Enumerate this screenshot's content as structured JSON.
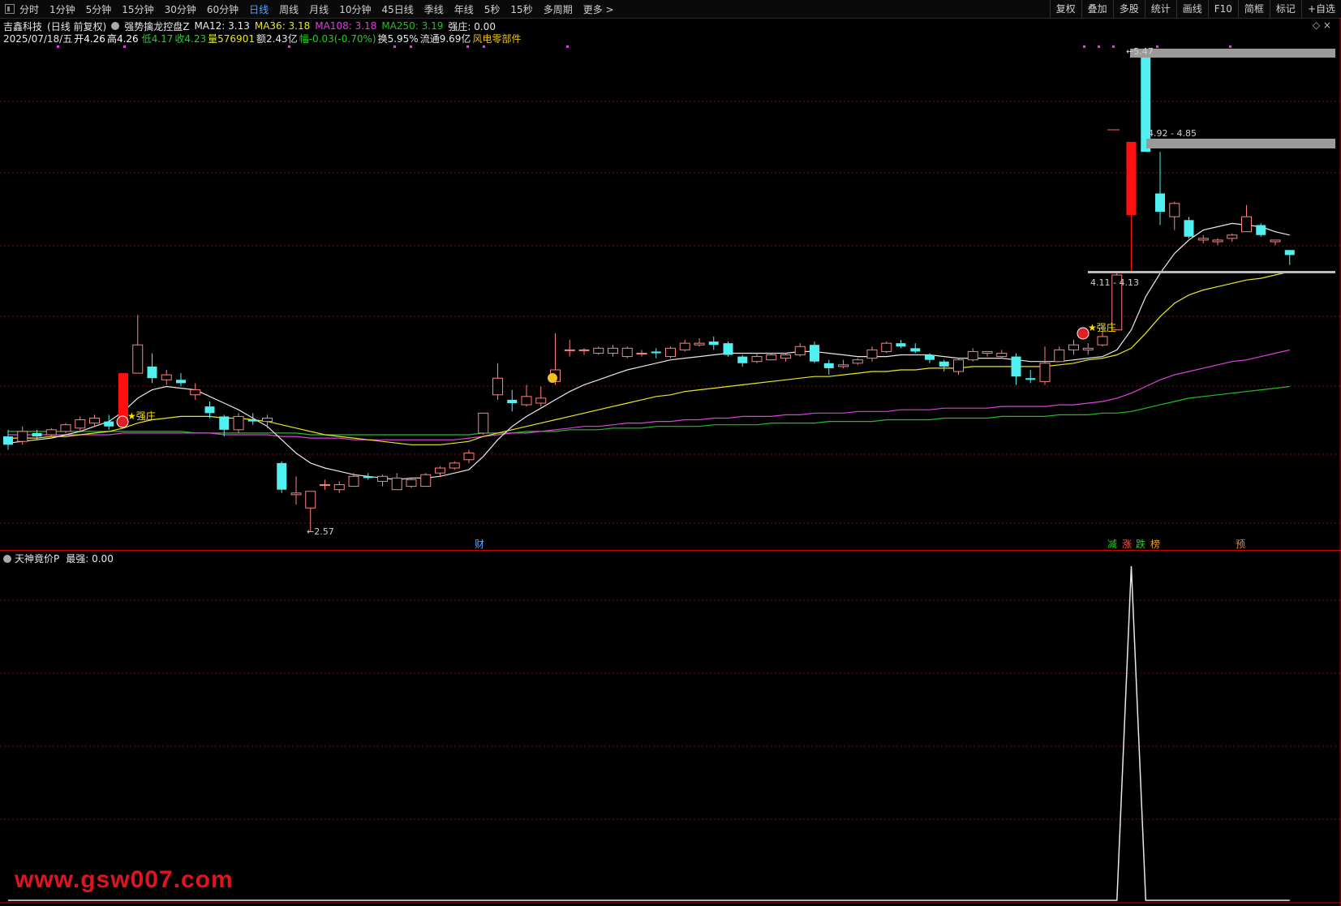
{
  "toolbar": {
    "periods": [
      "分时",
      "1分钟",
      "5分钟",
      "15分钟",
      "30分钟",
      "60分钟",
      "日线",
      "周线",
      "月线",
      "10分钟",
      "45日线",
      "季线",
      "年线",
      "5秒",
      "15秒",
      "多周期",
      "更多 >"
    ],
    "active_period": "日线",
    "right_tools": [
      "复权",
      "叠加",
      "多股",
      "统计",
      "画线",
      "F10",
      "简框",
      "标记",
      "+自选"
    ]
  },
  "header": {
    "stock_name": "吉鑫科技",
    "mode": "(日线 前复权)",
    "formula_name": "强势擒龙控盘Z",
    "ma12": "MA12: 3.13",
    "ma36": "MA36: 3.18",
    "ma108": "MA108: 3.18",
    "ma250": "MA250: 3.19",
    "strength": "强庄: 0.00",
    "settings_icon": "◇ ×"
  },
  "quote": {
    "date": "2025/07/18/五",
    "open": "开4.26",
    "high": "高4.26",
    "low": "低4.17",
    "close": "收4.23",
    "volume": "量576901",
    "amount": "额2.43亿",
    "change": "幅-0.03(-0.70%)",
    "turnover": "换5.95%",
    "float_cap": "流通9.69亿",
    "sector": "风电零部件"
  },
  "colors": {
    "up": "#ff8080",
    "up_strong": "#ff1010",
    "down": "#50f0f0",
    "ma12": "#e8e8e8",
    "ma36": "#e8e820",
    "ma108": "#e040e0",
    "ma250": "#20c020",
    "grid": "#7a1010",
    "accent_active": "#4fa8ff"
  },
  "chart_annotations": {
    "low_label": "←2.57",
    "high_label": "←5.47",
    "zone_upper": "4.92 - 4.85",
    "zone_lower": "4.11 - 4.13",
    "signal_label_1": "★强庄",
    "signal_label_2": "★强庄",
    "finance_mark": "财",
    "markers": [
      "减",
      "涨",
      "跌",
      "榜",
      "预"
    ]
  },
  "indicator": {
    "name": "天神竟价P",
    "value": "最强: 0.00"
  },
  "watermark": "www.gsw007.com",
  "chart_data": {
    "type": "candlestick",
    "price_range": [
      2.57,
      5.47
    ],
    "candles": [
      [
        3.14,
        3.09,
        3.18,
        3.06
      ],
      [
        3.11,
        3.17,
        3.2,
        3.09
      ],
      [
        3.16,
        3.14,
        3.18,
        3.12
      ],
      [
        3.15,
        3.18,
        3.19,
        3.14
      ],
      [
        3.17,
        3.21,
        3.22,
        3.16
      ],
      [
        3.19,
        3.24,
        3.26,
        3.17
      ],
      [
        3.22,
        3.25,
        3.27,
        3.2
      ],
      [
        3.23,
        3.2,
        3.27,
        3.18
      ],
      [
        3.21,
        3.52,
        3.52,
        3.2
      ],
      [
        3.52,
        3.69,
        3.87,
        3.52
      ],
      [
        3.56,
        3.49,
        3.64,
        3.46
      ],
      [
        3.48,
        3.51,
        3.54,
        3.45
      ],
      [
        3.48,
        3.46,
        3.52,
        3.44
      ],
      [
        3.39,
        3.42,
        3.46,
        3.36
      ],
      [
        3.32,
        3.28,
        3.35,
        3.25
      ],
      [
        3.26,
        3.18,
        3.27,
        3.14
      ],
      [
        3.18,
        3.26,
        3.28,
        3.16
      ],
      [
        3.24,
        3.23,
        3.28,
        3.21
      ],
      [
        3.23,
        3.25,
        3.27,
        3.19
      ],
      [
        2.98,
        2.82,
        2.99,
        2.8
      ],
      [
        2.79,
        2.8,
        2.9,
        2.73
      ],
      [
        2.71,
        2.81,
        2.81,
        2.57
      ],
      [
        2.85,
        2.85,
        2.88,
        2.82
      ],
      [
        2.82,
        2.85,
        2.87,
        2.8
      ],
      [
        2.84,
        2.9,
        2.92,
        2.84
      ],
      [
        2.9,
        2.89,
        2.92,
        2.88
      ],
      [
        2.87,
        2.9,
        2.91,
        2.84
      ],
      [
        2.82,
        2.89,
        2.92,
        2.82
      ],
      [
        2.84,
        2.88,
        2.89,
        2.83
      ],
      [
        2.84,
        2.91,
        2.92,
        2.84
      ],
      [
        2.92,
        2.95,
        2.96,
        2.9
      ],
      [
        2.95,
        2.98,
        2.99,
        2.94
      ],
      [
        3.0,
        3.04,
        3.06,
        2.98
      ],
      [
        3.16,
        3.28,
        3.28,
        3.15
      ],
      [
        3.39,
        3.49,
        3.58,
        3.36
      ],
      [
        3.36,
        3.34,
        3.42,
        3.29
      ],
      [
        3.33,
        3.38,
        3.45,
        3.32
      ],
      [
        3.34,
        3.37,
        3.44,
        3.32
      ],
      [
        3.47,
        3.54,
        3.76,
        3.45
      ],
      [
        3.66,
        3.66,
        3.72,
        3.62
      ],
      [
        3.66,
        3.66,
        3.67,
        3.63
      ],
      [
        3.64,
        3.67,
        3.68,
        3.63
      ],
      [
        3.64,
        3.67,
        3.69,
        3.62
      ],
      [
        3.62,
        3.67,
        3.68,
        3.61
      ],
      [
        3.64,
        3.64,
        3.66,
        3.62
      ],
      [
        3.65,
        3.64,
        3.67,
        3.61
      ],
      [
        3.62,
        3.67,
        3.68,
        3.61
      ],
      [
        3.66,
        3.7,
        3.72,
        3.65
      ],
      [
        3.69,
        3.7,
        3.73,
        3.68
      ],
      [
        3.71,
        3.69,
        3.74,
        3.66
      ],
      [
        3.7,
        3.63,
        3.71,
        3.62
      ],
      [
        3.62,
        3.58,
        3.63,
        3.56
      ],
      [
        3.59,
        3.62,
        3.64,
        3.58
      ],
      [
        3.6,
        3.63,
        3.64,
        3.6
      ],
      [
        3.61,
        3.63,
        3.64,
        3.59
      ],
      [
        3.63,
        3.68,
        3.7,
        3.62
      ],
      [
        3.69,
        3.59,
        3.71,
        3.58
      ],
      [
        3.58,
        3.55,
        3.6,
        3.51
      ],
      [
        3.56,
        3.57,
        3.6,
        3.55
      ],
      [
        3.58,
        3.6,
        3.61,
        3.57
      ],
      [
        3.61,
        3.66,
        3.68,
        3.59
      ],
      [
        3.65,
        3.7,
        3.71,
        3.64
      ],
      [
        3.7,
        3.68,
        3.72,
        3.67
      ],
      [
        3.67,
        3.65,
        3.7,
        3.64
      ],
      [
        3.63,
        3.6,
        3.64,
        3.58
      ],
      [
        3.59,
        3.56,
        3.6,
        3.53
      ],
      [
        3.53,
        3.6,
        3.61,
        3.51
      ],
      [
        3.6,
        3.65,
        3.67,
        3.59
      ],
      [
        3.64,
        3.65,
        3.65,
        3.62
      ],
      [
        3.62,
        3.64,
        3.66,
        3.61
      ],
      [
        3.62,
        3.5,
        3.64,
        3.45
      ],
      [
        3.49,
        3.48,
        3.54,
        3.46
      ],
      [
        3.47,
        3.58,
        3.68,
        3.45
      ],
      [
        3.59,
        3.66,
        3.68,
        3.59
      ],
      [
        3.66,
        3.69,
        3.72,
        3.63
      ],
      [
        3.66,
        3.67,
        3.7,
        3.63
      ],
      [
        3.69,
        3.74,
        3.77,
        3.68
      ],
      [
        3.78,
        4.11,
        4.12,
        3.78
      ],
      [
        4.47,
        4.91,
        4.91,
        4.13
      ],
      [
        5.47,
        4.85,
        5.47,
        4.85
      ],
      [
        4.6,
        4.49,
        4.85,
        4.41
      ],
      [
        4.46,
        4.54,
        4.55,
        4.38
      ],
      [
        4.44,
        4.34,
        4.46,
        4.33
      ],
      [
        4.32,
        4.33,
        4.35,
        4.3
      ],
      [
        4.31,
        4.32,
        4.33,
        4.29
      ],
      [
        4.33,
        4.35,
        4.36,
        4.31
      ],
      [
        4.37,
        4.46,
        4.53,
        4.37
      ],
      [
        4.41,
        4.35,
        4.42,
        4.34
      ],
      [
        4.31,
        4.32,
        4.32,
        4.29
      ],
      [
        4.26,
        4.23,
        4.26,
        4.17
      ]
    ],
    "ma12": [
      3.1,
      3.11,
      3.12,
      3.13,
      3.15,
      3.17,
      3.2,
      3.23,
      3.29,
      3.37,
      3.42,
      3.44,
      3.43,
      3.42,
      3.38,
      3.34,
      3.3,
      3.25,
      3.2,
      3.12,
      3.04,
      2.98,
      2.95,
      2.93,
      2.91,
      2.9,
      2.89,
      2.88,
      2.89,
      2.89,
      2.9,
      2.92,
      2.94,
      3.02,
      3.12,
      3.2,
      3.26,
      3.31,
      3.36,
      3.41,
      3.45,
      3.48,
      3.51,
      3.54,
      3.56,
      3.58,
      3.6,
      3.61,
      3.62,
      3.63,
      3.64,
      3.64,
      3.64,
      3.64,
      3.64,
      3.65,
      3.65,
      3.64,
      3.63,
      3.62,
      3.62,
      3.62,
      3.63,
      3.63,
      3.63,
      3.62,
      3.61,
      3.61,
      3.61,
      3.61,
      3.6,
      3.59,
      3.59,
      3.59,
      3.6,
      3.61,
      3.62,
      3.66,
      3.78,
      3.98,
      4.12,
      4.24,
      4.32,
      4.38,
      4.4,
      4.42,
      4.41,
      4.4,
      4.37,
      4.35
    ],
    "ma36": [
      3.13,
      3.13,
      3.13,
      3.14,
      3.14,
      3.15,
      3.16,
      3.17,
      3.19,
      3.22,
      3.24,
      3.25,
      3.26,
      3.26,
      3.26,
      3.25,
      3.25,
      3.24,
      3.23,
      3.21,
      3.19,
      3.17,
      3.15,
      3.14,
      3.13,
      3.12,
      3.11,
      3.1,
      3.09,
      3.09,
      3.09,
      3.1,
      3.11,
      3.14,
      3.16,
      3.18,
      3.2,
      3.22,
      3.24,
      3.26,
      3.28,
      3.3,
      3.32,
      3.34,
      3.36,
      3.38,
      3.39,
      3.41,
      3.42,
      3.43,
      3.44,
      3.45,
      3.46,
      3.47,
      3.48,
      3.49,
      3.5,
      3.5,
      3.51,
      3.52,
      3.53,
      3.53,
      3.54,
      3.54,
      3.55,
      3.55,
      3.55,
      3.56,
      3.56,
      3.56,
      3.56,
      3.56,
      3.56,
      3.57,
      3.58,
      3.6,
      3.61,
      3.63,
      3.67,
      3.76,
      3.86,
      3.94,
      3.99,
      4.02,
      4.04,
      4.06,
      4.08,
      4.09,
      4.11,
      4.13
    ],
    "ma108": [
      3.15,
      3.15,
      3.15,
      3.15,
      3.15,
      3.15,
      3.15,
      3.15,
      3.16,
      3.16,
      3.16,
      3.16,
      3.16,
      3.16,
      3.16,
      3.15,
      3.15,
      3.15,
      3.15,
      3.14,
      3.14,
      3.13,
      3.13,
      3.13,
      3.12,
      3.12,
      3.12,
      3.12,
      3.12,
      3.12,
      3.12,
      3.12,
      3.13,
      3.14,
      3.15,
      3.16,
      3.16,
      3.17,
      3.18,
      3.19,
      3.2,
      3.2,
      3.21,
      3.22,
      3.22,
      3.23,
      3.23,
      3.24,
      3.24,
      3.25,
      3.25,
      3.26,
      3.26,
      3.26,
      3.27,
      3.27,
      3.28,
      3.28,
      3.28,
      3.29,
      3.29,
      3.29,
      3.3,
      3.3,
      3.3,
      3.31,
      3.31,
      3.31,
      3.31,
      3.32,
      3.32,
      3.32,
      3.32,
      3.33,
      3.33,
      3.34,
      3.35,
      3.37,
      3.4,
      3.44,
      3.48,
      3.51,
      3.53,
      3.55,
      3.57,
      3.59,
      3.6,
      3.62,
      3.64,
      3.66
    ],
    "ma250": [
      3.17,
      3.17,
      3.17,
      3.17,
      3.17,
      3.17,
      3.17,
      3.17,
      3.17,
      3.17,
      3.17,
      3.17,
      3.17,
      3.16,
      3.16,
      3.16,
      3.16,
      3.16,
      3.16,
      3.16,
      3.16,
      3.15,
      3.15,
      3.15,
      3.15,
      3.15,
      3.15,
      3.15,
      3.15,
      3.15,
      3.15,
      3.15,
      3.15,
      3.16,
      3.16,
      3.16,
      3.17,
      3.17,
      3.17,
      3.18,
      3.18,
      3.18,
      3.19,
      3.19,
      3.19,
      3.2,
      3.2,
      3.2,
      3.2,
      3.21,
      3.21,
      3.21,
      3.21,
      3.22,
      3.22,
      3.22,
      3.22,
      3.23,
      3.23,
      3.23,
      3.23,
      3.24,
      3.24,
      3.24,
      3.24,
      3.25,
      3.25,
      3.25,
      3.25,
      3.26,
      3.26,
      3.26,
      3.26,
      3.27,
      3.27,
      3.27,
      3.28,
      3.28,
      3.29,
      3.31,
      3.33,
      3.35,
      3.37,
      3.38,
      3.39,
      3.4,
      3.41,
      3.42,
      3.43,
      3.44
    ],
    "indicator_values": [
      0,
      0,
      0,
      0,
      0,
      0,
      0,
      0,
      0,
      0,
      0,
      0,
      0,
      0,
      0,
      0,
      0,
      0,
      0,
      0,
      0,
      0,
      0,
      0,
      0,
      0,
      0,
      0,
      0,
      0,
      0,
      0,
      0,
      0,
      0,
      0,
      0,
      0,
      0,
      0,
      0,
      0,
      0,
      0,
      0,
      0,
      0,
      0,
      0,
      0,
      0,
      0,
      0,
      0,
      0,
      0,
      0,
      0,
      0,
      0,
      0,
      0,
      0,
      0,
      0,
      0,
      0,
      0,
      0,
      0,
      0,
      0,
      0,
      0,
      0,
      0,
      0,
      0,
      1,
      0,
      0,
      0,
      0,
      0,
      0,
      0,
      0,
      0,
      0,
      0
    ]
  }
}
